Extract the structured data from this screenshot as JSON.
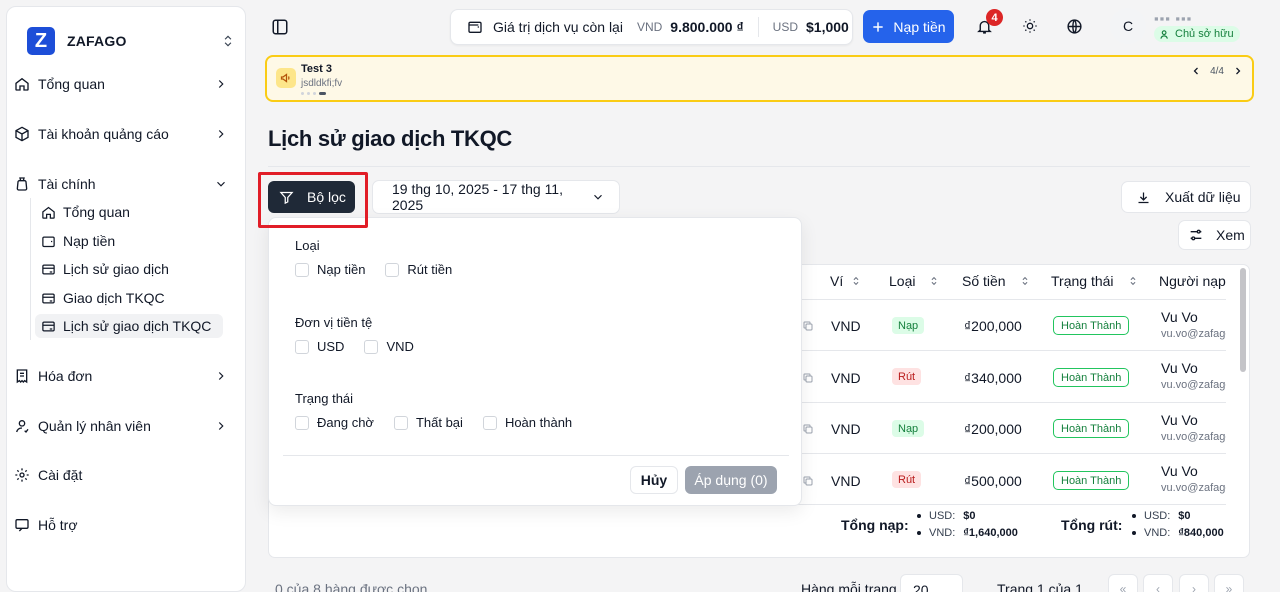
{
  "brand": {
    "name": "ZAFAGO",
    "logo_letter": "Z"
  },
  "sidebar": {
    "items": [
      {
        "label": "Tổng quan",
        "icon": "home-icon"
      },
      {
        "label": "Tài khoản quảng cáo",
        "icon": "box-icon"
      },
      {
        "label": "Tài chính",
        "icon": "wallet-icon",
        "expanded": true
      },
      {
        "label": "Hóa đơn",
        "icon": "receipt-icon"
      },
      {
        "label": "Quản lý nhân viên",
        "icon": "user-icon"
      },
      {
        "label": "Cài đặt",
        "icon": "gear-icon"
      },
      {
        "label": "Hỗ trợ",
        "icon": "chat-icon"
      }
    ],
    "sub_items": [
      {
        "label": "Tổng quan",
        "icon": "home-icon"
      },
      {
        "label": "Nạp tiền",
        "icon": "wallet-icon"
      },
      {
        "label": "Lịch sử giao dịch",
        "icon": "card-history-icon"
      },
      {
        "label": "Giao dịch TKQC",
        "icon": "card-history-icon"
      },
      {
        "label": "Lịch sử giao dịch TKQC",
        "icon": "card-history-icon",
        "active": true
      }
    ]
  },
  "topbar": {
    "balance_label": "Giá trị dịch vụ còn lại",
    "vnd_currency": "VND",
    "vnd_amount": "9.800.000 ₫",
    "usd_currency": "USD",
    "usd_amount": "$1,000",
    "topup_label": "Nạp tiền",
    "notification_count": "4",
    "avatar_letter": "C",
    "user_name": "▪▪▪ ▪▪▪",
    "role_badge": "Chủ sở hữu"
  },
  "announcement": {
    "title": "Test 3",
    "body": "jsdldkfi;fv",
    "counter": "4/4"
  },
  "page": {
    "title": "Lịch sử giao dịch TKQC",
    "filter_label": "Bộ lọc",
    "date_range": "19 thg 10, 2025 - 17 thg 11, 2025",
    "export_label": "Xuất dữ liệu",
    "view_label": "Xem"
  },
  "table": {
    "headers": {
      "wallet": "Ví",
      "type": "Loại",
      "amount": "Số tiền",
      "status": "Trạng thái",
      "payer": "Người nạp"
    },
    "rows": [
      {
        "wallet": "VND",
        "type": "Nạp",
        "kind": "nap",
        "amount": "₫200,000",
        "status": "Hoàn Thành",
        "name": "Vu Vo",
        "email": "vu.vo@zafago.com"
      },
      {
        "wallet": "VND",
        "type": "Rút",
        "kind": "rut",
        "amount": "₫340,000",
        "status": "Hoàn Thành",
        "name": "Vu Vo",
        "email": "vu.vo@zafago.com"
      },
      {
        "wallet": "VND",
        "type": "Nạp",
        "kind": "nap",
        "amount": "₫200,000",
        "status": "Hoàn Thành",
        "name": "Vu Vo",
        "email": "vu.vo@zafago.com"
      },
      {
        "wallet": "VND",
        "type": "Rút",
        "kind": "rut",
        "amount": "₫500,000",
        "status": "Hoàn Thành",
        "name": "Vu Vo",
        "email": "vu.vo@zafago.com"
      }
    ]
  },
  "totals": {
    "deposit_label": "Tổng nạp:",
    "deposit_usd_key": "USD:",
    "deposit_usd": "$0",
    "deposit_vnd_key": "VND:",
    "deposit_vnd": "₫1,640,000",
    "withdraw_label": "Tổng rút:",
    "withdraw_usd_key": "USD:",
    "withdraw_usd": "$0",
    "withdraw_vnd_key": "VND:",
    "withdraw_vnd": "₫840,000"
  },
  "footer": {
    "selected": "0 của 8 hàng được chọn",
    "rows_per_page_label": "Hàng mỗi trang",
    "rows_per_page": "20",
    "page_info": "Trang 1 của 1"
  },
  "filter_popover": {
    "type_label": "Loại",
    "type_options": [
      "Nạp tiền",
      "Rút tiền"
    ],
    "currency_label": "Đơn vị tiền tệ",
    "currency_options": [
      "USD",
      "VND"
    ],
    "status_label": "Trạng thái",
    "status_options": [
      "Đang chờ",
      "Thất bại",
      "Hoàn thành"
    ],
    "cancel_label": "Hủy",
    "apply_label": "Áp dụng (0)"
  },
  "colors": {
    "primary": "#2563eb",
    "dark_button": "#1f2937",
    "highlight": "#e11d27",
    "announce_border": "#facc15"
  }
}
